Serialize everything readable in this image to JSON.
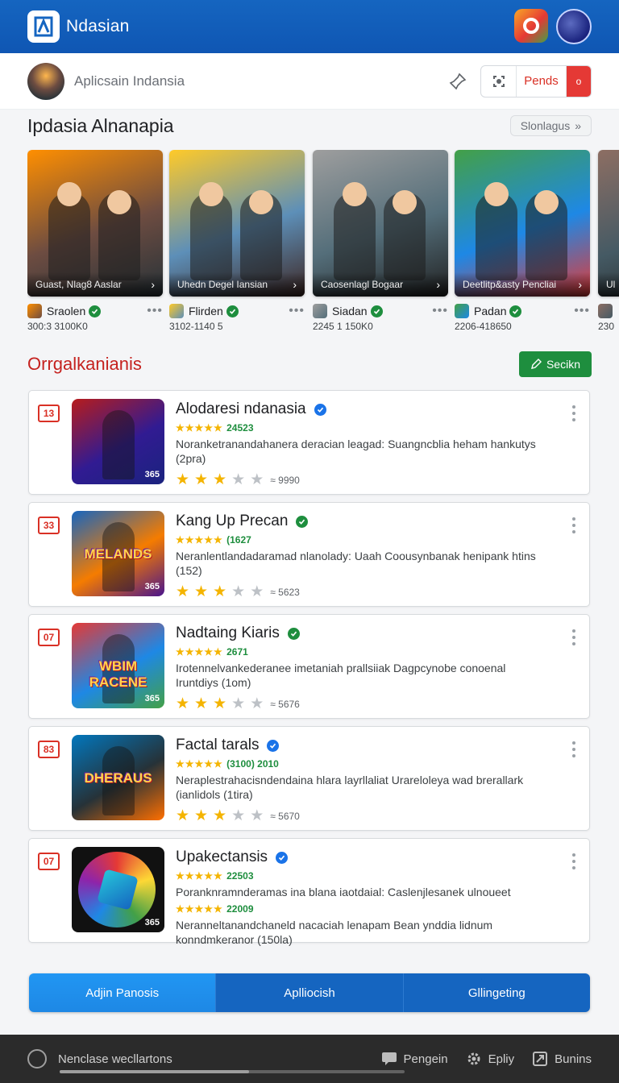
{
  "app": {
    "title": "Ndasian"
  },
  "subheader": {
    "title": "Aplicsain Indansia",
    "segment_label": "Pends",
    "segment_badge": "o"
  },
  "featured": {
    "title": "Ipdasia Alnanapia",
    "more_label": "Slonlagus",
    "cards": [
      {
        "caption": "Guast, Nlag8 Aaslar",
        "name": "Sraolen",
        "code": "300:3 3100K0",
        "verified": "green",
        "theme": [
          "#ff8f00",
          "#6d4c41",
          "#263238"
        ]
      },
      {
        "caption": "Uhedn Degel Iansian",
        "name": "Flirden",
        "code": "3102-1140 5",
        "verified": "green",
        "theme": [
          "#ffca28",
          "#5d8fb8",
          "#3e2723"
        ]
      },
      {
        "caption": "Caosenlagl Bogaar",
        "name": "Siadan",
        "code": "2245 1 150K0",
        "verified": "green",
        "theme": [
          "#9e9e9e",
          "#546e7a",
          "#212121"
        ]
      },
      {
        "caption": "Deetlitp&asty Pencliai",
        "name": "Padan",
        "code": "2206-418650",
        "verified": "green",
        "theme": [
          "#43a047",
          "#1e88e5",
          "#e53935"
        ]
      },
      {
        "caption": "Ul",
        "name": "",
        "code": "230",
        "verified": "",
        "theme": [
          "#8d6e63",
          "#455a64",
          "#212121"
        ]
      }
    ]
  },
  "list": {
    "title": "Orrgalkanianis",
    "action_label": "Secikn",
    "items": [
      {
        "rank": "13",
        "title": "Alodaresi ndanasia",
        "verified": "blue",
        "stars_text": "24523",
        "desc": "Noranketranandahanera deracian leagad: Suangncblia heham hankutys (2pra)",
        "rating": 3,
        "count": "9990",
        "thumb_tag": "365",
        "thumb_text": "",
        "thumb_colors": [
          "#b71c1c",
          "#311b92",
          "#1a237e"
        ]
      },
      {
        "rank": "33",
        "title": "Kang Up Precan",
        "verified": "green",
        "stars_text": "(1627",
        "desc": "Neranlentlandadaramad nlanolady: Uaah Coousynbanak henipank htins (152)",
        "rating": 3,
        "count": "5623",
        "thumb_tag": "365",
        "thumb_text": "MELANDS",
        "thumb_colors": [
          "#1565c0",
          "#f57c00",
          "#4a148c"
        ]
      },
      {
        "rank": "07",
        "title": "Nadtaing Kiaris",
        "verified": "green",
        "stars_text": "2671",
        "desc": "Irotennelvankederanee imetaniah prallsiiak Dagpcynobe conoenal Iruntdiys (1om)",
        "rating": 3,
        "count": "5676",
        "thumb_tag": "365",
        "thumb_text": "WBIM RACENE",
        "thumb_colors": [
          "#e53935",
          "#1e88e5",
          "#43a047"
        ]
      },
      {
        "rank": "83",
        "title": "Factal tarals",
        "verified": "blue",
        "stars_text": "(3100) 2010",
        "desc": "Neraplestrahacisndendaina hlara layrllaliat Urareloleya wad brerallark (ianlidols (1tira)",
        "rating": 3,
        "count": "5670",
        "thumb_tag": "",
        "thumb_text": "DHERAUS",
        "thumb_colors": [
          "#0277bd",
          "#263238",
          "#ff6f00"
        ]
      },
      {
        "rank": "07",
        "title": "Upakectansis",
        "verified": "blue",
        "stars_text": "22503",
        "stars_text_2": "22009",
        "desc": "Poranknramnderamas ina blana iaotdaial: Caslenjlesanek ulnoueet",
        "desc_2": "Neranneltanandchaneld nacaciah lenapam Bean ynddia lidnum konndmkeranor (150la)",
        "rating": 0,
        "count": "",
        "thumb_tag": "365",
        "thumb_text": "",
        "thumb_colors": [
          "#e53935",
          "#fdd835",
          "#1e88e5"
        ]
      }
    ]
  },
  "tabs": [
    {
      "label": "Adjin Panosis",
      "active": true
    },
    {
      "label": "Aplliocish",
      "active": false
    },
    {
      "label": "Gllingeting",
      "active": false
    }
  ],
  "footer": {
    "text": "Nenclase wecllartons",
    "progress": 0.55,
    "actions": [
      {
        "label": "Pengein",
        "icon": "chat-icon"
      },
      {
        "label": "Epliy",
        "icon": "gear-icon"
      },
      {
        "label": "Bunins",
        "icon": "share-icon"
      }
    ]
  }
}
